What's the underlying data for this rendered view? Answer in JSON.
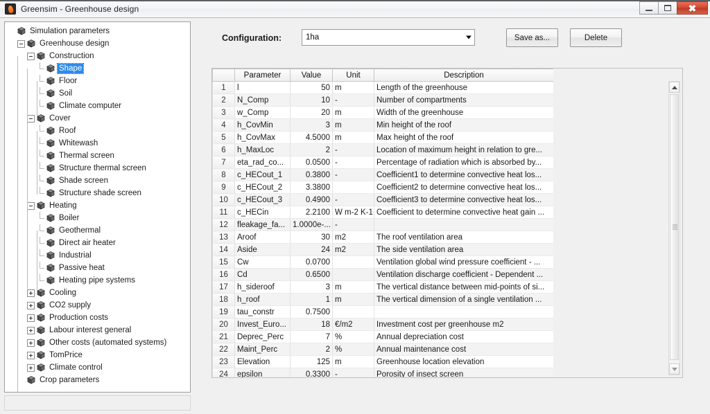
{
  "window": {
    "title": "Greensim - Greenhouse design",
    "icon": "app-flame-icon",
    "buttons": {
      "minimize": "—",
      "maximize": "□",
      "close": "✕"
    }
  },
  "colors": {
    "selection": "#2f8ae8",
    "close_button": "#d44a32",
    "titlebar": "#f3f4f6",
    "row_alt": "#f3f3f3"
  },
  "tree": {
    "nodes": [
      {
        "label": "Simulation parameters",
        "depth": 0,
        "state": "none",
        "selected": false
      },
      {
        "label": "Greenhouse design",
        "depth": 1,
        "state": "expanded",
        "selected": false
      },
      {
        "label": "Construction",
        "depth": 2,
        "state": "expanded",
        "selected": false
      },
      {
        "label": "Shape",
        "depth": 3,
        "state": "leaf",
        "selected": true
      },
      {
        "label": "Floor",
        "depth": 3,
        "state": "leaf",
        "selected": false
      },
      {
        "label": "Soil",
        "depth": 3,
        "state": "leaf",
        "selected": false
      },
      {
        "label": "Climate computer",
        "depth": 3,
        "state": "leaf",
        "selected": false
      },
      {
        "label": "Cover",
        "depth": 2,
        "state": "expanded",
        "selected": false
      },
      {
        "label": "Roof",
        "depth": 3,
        "state": "leaf",
        "selected": false
      },
      {
        "label": "Whitewash",
        "depth": 3,
        "state": "leaf",
        "selected": false
      },
      {
        "label": "Thermal screen",
        "depth": 3,
        "state": "leaf",
        "selected": false
      },
      {
        "label": "Structure thermal screen",
        "depth": 3,
        "state": "leaf",
        "selected": false
      },
      {
        "label": "Shade screen",
        "depth": 3,
        "state": "leaf",
        "selected": false
      },
      {
        "label": "Structure shade screen",
        "depth": 3,
        "state": "leaf",
        "selected": false
      },
      {
        "label": "Heating",
        "depth": 2,
        "state": "expanded",
        "selected": false
      },
      {
        "label": "Boiler",
        "depth": 3,
        "state": "leaf",
        "selected": false
      },
      {
        "label": "Geothermal",
        "depth": 3,
        "state": "leaf",
        "selected": false
      },
      {
        "label": "Direct air heater",
        "depth": 3,
        "state": "leaf",
        "selected": false
      },
      {
        "label": "Industrial",
        "depth": 3,
        "state": "leaf",
        "selected": false
      },
      {
        "label": "Passive heat",
        "depth": 3,
        "state": "leaf",
        "selected": false
      },
      {
        "label": "Heating pipe systems",
        "depth": 3,
        "state": "leaf",
        "selected": false
      },
      {
        "label": "Cooling",
        "depth": 2,
        "state": "collapsed",
        "selected": false
      },
      {
        "label": "CO2 supply",
        "depth": 2,
        "state": "collapsed",
        "selected": false
      },
      {
        "label": "Production costs",
        "depth": 2,
        "state": "collapsed",
        "selected": false
      },
      {
        "label": "Labour interest general",
        "depth": 2,
        "state": "collapsed",
        "selected": false
      },
      {
        "label": "Other costs (automated systems)",
        "depth": 2,
        "state": "collapsed",
        "selected": false
      },
      {
        "label": "TomPrice",
        "depth": 2,
        "state": "collapsed",
        "selected": false
      },
      {
        "label": "Climate control",
        "depth": 2,
        "state": "collapsed",
        "selected": false
      },
      {
        "label": "Crop parameters",
        "depth": 1,
        "state": "leaf",
        "selected": false
      }
    ]
  },
  "toolbar": {
    "configuration_label": "Configuration:",
    "configuration_value": "1ha",
    "configuration_options": [
      "1ha"
    ],
    "save_as_label": "Save as...",
    "delete_label": "Delete"
  },
  "table": {
    "columns": [
      "",
      "Parameter",
      "Value",
      "Unit",
      "Description"
    ],
    "rows": [
      {
        "n": "1",
        "parameter": "l",
        "value": "50",
        "unit": "m",
        "description": "Length of the greenhouse"
      },
      {
        "n": "2",
        "parameter": "N_Comp",
        "value": "10",
        "unit": "-",
        "description": "Number of compartments"
      },
      {
        "n": "3",
        "parameter": "w_Comp",
        "value": "20",
        "unit": "m",
        "description": "Width of the greenhouse"
      },
      {
        "n": "4",
        "parameter": "h_CovMin",
        "value": "3",
        "unit": "m",
        "description": "Min height of the roof"
      },
      {
        "n": "5",
        "parameter": "h_CovMax",
        "value": "4.5000",
        "unit": "m",
        "description": "Max height of the roof"
      },
      {
        "n": "6",
        "parameter": "h_MaxLoc",
        "value": "2",
        "unit": "-",
        "description": "Location of maximum height in relation to gre..."
      },
      {
        "n": "7",
        "parameter": "eta_rad_co...",
        "value": "0.0500",
        "unit": "-",
        "description": "Percentage of radiation which is absorbed by..."
      },
      {
        "n": "8",
        "parameter": "c_HECout_1",
        "value": "0.3800",
        "unit": "-",
        "description": "Coefficient1 to determine convective heat los..."
      },
      {
        "n": "9",
        "parameter": "c_HECout_2",
        "value": "3.3800",
        "unit": "",
        "description": "Coefficient2 to determine convective heat los..."
      },
      {
        "n": "10",
        "parameter": "c_HECout_3",
        "value": "0.4900",
        "unit": "-",
        "description": "Coefficient3 to determine convective heat los..."
      },
      {
        "n": "11",
        "parameter": "c_HECin",
        "value": "2.2100",
        "unit": "W m-2 K-1",
        "description": "Coefficient to determine convective heat gain ..."
      },
      {
        "n": "12",
        "parameter": "fleakage_fa...",
        "value": "1.0000e-...",
        "unit": "-",
        "description": ""
      },
      {
        "n": "13",
        "parameter": "Aroof",
        "value": "30",
        "unit": "m2",
        "description": "The roof ventilation area"
      },
      {
        "n": "14",
        "parameter": "Aside",
        "value": "24",
        "unit": "m2",
        "description": "The side ventilation area"
      },
      {
        "n": "15",
        "parameter": "Cw",
        "value": "0.0700",
        "unit": "",
        "description": "Ventilation global wind pressure coefficient - ..."
      },
      {
        "n": "16",
        "parameter": "Cd",
        "value": "0.6500",
        "unit": "",
        "description": "Ventilation discharge coefficient - Dependent ..."
      },
      {
        "n": "17",
        "parameter": "h_sideroof",
        "value": "3",
        "unit": "m",
        "description": "The vertical distance between mid-points of si..."
      },
      {
        "n": "18",
        "parameter": "h_roof",
        "value": "1",
        "unit": "m",
        "description": "The vertical dimension of a single ventilation ..."
      },
      {
        "n": "19",
        "parameter": "tau_constr",
        "value": "0.7500",
        "unit": "",
        "description": ""
      },
      {
        "n": "20",
        "parameter": "Invest_Euro...",
        "value": "18",
        "unit": "€/m2",
        "description": "Investment cost per greenhouse m2"
      },
      {
        "n": "21",
        "parameter": "Deprec_Perc",
        "value": "7",
        "unit": "%",
        "description": "Annual depreciation cost"
      },
      {
        "n": "22",
        "parameter": "Maint_Perc",
        "value": "2",
        "unit": "%",
        "description": "Annual maintenance cost"
      },
      {
        "n": "23",
        "parameter": "Elevation",
        "value": "125",
        "unit": "m",
        "description": "Greenhouse location elevation"
      },
      {
        "n": "24",
        "parameter": "epsilon",
        "value": "0.3300",
        "unit": "-",
        "description": "Porosity of insect screen"
      }
    ]
  },
  "scrollbar": {
    "up_icon": "triangle-up-icon",
    "down_icon": "triangle-down-icon",
    "grip_icon": "scrollbar-grip-icon"
  }
}
